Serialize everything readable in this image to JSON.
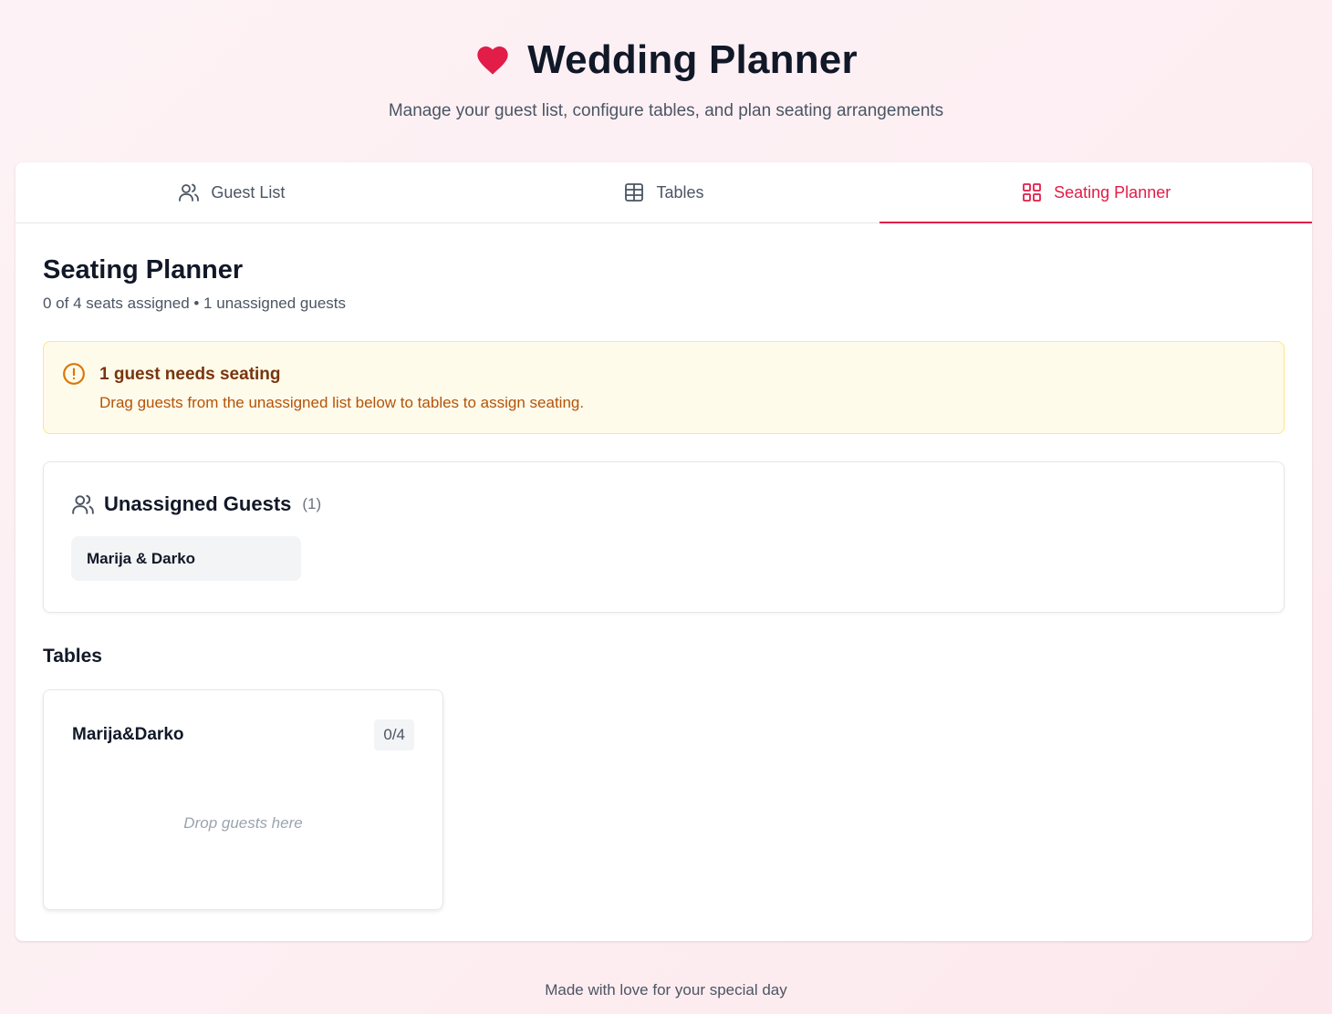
{
  "app": {
    "title": "Wedding Planner",
    "subtitle": "Manage your guest list, configure tables, and plan seating arrangements"
  },
  "tabs": [
    {
      "label": "Guest List",
      "icon": "users-icon",
      "active": false
    },
    {
      "label": "Tables",
      "icon": "table-icon",
      "active": false
    },
    {
      "label": "Seating Planner",
      "icon": "grid-icon",
      "active": true
    }
  ],
  "planner": {
    "title": "Seating Planner",
    "summary": "0 of 4 seats assigned • 1 unassigned guests"
  },
  "alert": {
    "title": "1 guest needs seating",
    "message": "Drag guests from the unassigned list below to tables to assign seating.",
    "icon": "alert-circle-icon"
  },
  "unassigned": {
    "title": "Unassigned Guests",
    "count": "(1)",
    "guests": [
      {
        "name": "Marija & Darko"
      }
    ]
  },
  "tables_section": {
    "title": "Tables",
    "tables": [
      {
        "name": "Marija&Darko",
        "occupancy": "0/4",
        "placeholder": "Drop guests here"
      }
    ]
  },
  "footer": {
    "text": "Made with love for your special day"
  },
  "colors": {
    "accent": "#e11d48",
    "alert_bg": "#fffbea",
    "alert_border": "#fde68a"
  }
}
